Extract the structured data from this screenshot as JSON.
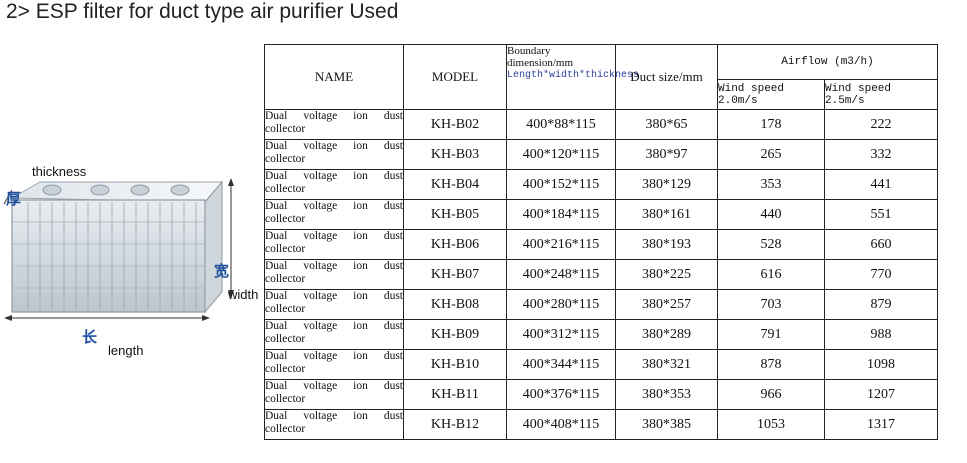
{
  "page": {
    "title": "2> ESP filter for duct type air purifier Used"
  },
  "product_image": {
    "labels": {
      "thickness": "thickness",
      "width": "width",
      "length": "length",
      "thickness_cjk": "厚",
      "width_cjk": "宽",
      "length_cjk": "长"
    }
  },
  "table": {
    "headers": {
      "name": "NAME",
      "model": "MODEL",
      "boundary_title": "Boundary dimension/mm",
      "boundary_sub": "Length*width*thickness",
      "duct": "Duct size/mm",
      "airflow": "Airflow (m3/h)",
      "wind1": "Wind speed 2.0m/s",
      "wind2": "Wind speed 2.5m/s"
    },
    "rows": [
      {
        "name": "Dual voltage ion dust collector",
        "model": "KH-B02",
        "boundary": "400*88*115",
        "duct": "380*65",
        "air1": "178",
        "air2": "222"
      },
      {
        "name": "Dual voltage ion dust collector",
        "model": "KH-B03",
        "boundary": "400*120*115",
        "duct": "380*97",
        "air1": "265",
        "air2": "332"
      },
      {
        "name": "Dual voltage ion dust collector",
        "model": "KH-B04",
        "boundary": "400*152*115",
        "duct": "380*129",
        "air1": "353",
        "air2": "441"
      },
      {
        "name": "Dual voltage ion dust collector",
        "model": "KH-B05",
        "boundary": "400*184*115",
        "duct": "380*161",
        "air1": "440",
        "air2": "551"
      },
      {
        "name": "Dual voltage ion dust collector",
        "model": "KH-B06",
        "boundary": "400*216*115",
        "duct": "380*193",
        "air1": "528",
        "air2": "660"
      },
      {
        "name": "Dual voltage ion dust collector",
        "model": "KH-B07",
        "boundary": "400*248*115",
        "duct": "380*225",
        "air1": "616",
        "air2": "770"
      },
      {
        "name": "Dual voltage ion dust collector",
        "model": "KH-B08",
        "boundary": "400*280*115",
        "duct": "380*257",
        "air1": "703",
        "air2": "879"
      },
      {
        "name": "Dual voltage ion dust collector",
        "model": "KH-B09",
        "boundary": "400*312*115",
        "duct": "380*289",
        "air1": "791",
        "air2": "988"
      },
      {
        "name": "Dual voltage ion dust collector",
        "model": "KH-B10",
        "boundary": "400*344*115",
        "duct": "380*321",
        "air1": "878",
        "air2": "1098"
      },
      {
        "name": "Dual voltage ion dust collector",
        "model": "KH-B11",
        "boundary": "400*376*115",
        "duct": "380*353",
        "air1": "966",
        "air2": "1207"
      },
      {
        "name": "Dual voltage ion dust collector",
        "model": "KH-B12",
        "boundary": "400*408*115",
        "duct": "380*385",
        "air1": "1053",
        "air2": "1317"
      }
    ]
  }
}
